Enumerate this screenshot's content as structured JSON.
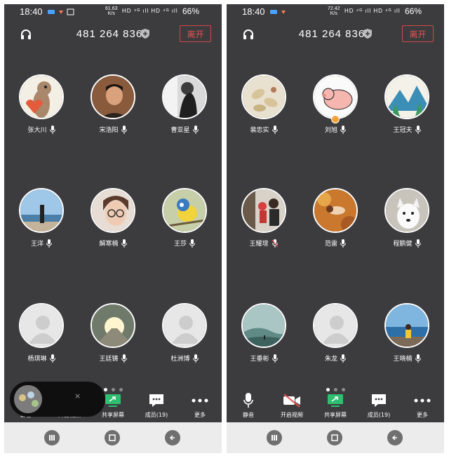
{
  "left_screen": {
    "status_bar": {
      "time": "18:40",
      "speed": "61.63",
      "speed_unit": "K/s",
      "network": "HD ⁴ᴳ ıll HD ⁴ᴳ ıll",
      "battery": "66%"
    },
    "meeting_id": "481 264 836",
    "leave_label": "离开",
    "participants": [
      {
        "name": "张大川",
        "avatar": "cartoon-dog-avatar"
      },
      {
        "name": "宋浩阳",
        "avatar": "man-portrait-avatar"
      },
      {
        "name": "曹亚星",
        "avatar": "bw-woman-avatar"
      },
      {
        "name": "王洋",
        "avatar": "seaside-person-avatar"
      },
      {
        "name": "解寒楠",
        "avatar": "glasses-girl-avatar"
      },
      {
        "name": "王莎",
        "avatar": "bird-avatar"
      },
      {
        "name": "杨琪琳",
        "avatar": "default-avatar"
      },
      {
        "name": "王廷铸",
        "avatar": "sunlight-road-avatar"
      },
      {
        "name": "杜洲博",
        "avatar": "default-avatar"
      }
    ],
    "toolbar": [
      {
        "label": "静音",
        "icon": "mic-icon"
      },
      {
        "label": "开启视频",
        "icon": "video-icon"
      },
      {
        "label": "共享屏幕",
        "icon": "share-screen-icon"
      },
      {
        "label": "成员(19)",
        "icon": "members-icon"
      },
      {
        "label": "更多",
        "icon": "more-icon"
      }
    ],
    "floating_close": "×"
  },
  "right_screen": {
    "status_bar": {
      "time": "18:40",
      "speed": "72.42",
      "speed_unit": "K/s",
      "network": "HD ⁴ᴳ ıll HD ⁴ᴳ ıll",
      "battery": "66%"
    },
    "meeting_id": "481 264 836",
    "leave_label": "离开",
    "participants": [
      {
        "name": "裴忠实",
        "avatar": "peanuts-avatar"
      },
      {
        "name": "刘旭",
        "avatar": "pig-cartoon-avatar"
      },
      {
        "name": "王冠夫",
        "avatar": "mountain-art-avatar"
      },
      {
        "name": "王耀增",
        "avatar": "family-photo-avatar"
      },
      {
        "name": "范雷",
        "avatar": "autumn-leaves-avatar"
      },
      {
        "name": "程鹏健",
        "avatar": "white-dog-avatar"
      },
      {
        "name": "王垂彬",
        "avatar": "misty-landscape-avatar"
      },
      {
        "name": "朱龙",
        "avatar": "default-avatar"
      },
      {
        "name": "王晓楠",
        "avatar": "seaside-girl-avatar"
      }
    ],
    "toolbar": [
      {
        "label": "静音",
        "icon": "mic-icon"
      },
      {
        "label": "开启视频",
        "icon": "video-off-icon"
      },
      {
        "label": "共享屏幕",
        "icon": "share-screen-icon"
      },
      {
        "label": "成员(19)",
        "icon": "members-icon"
      },
      {
        "label": "更多",
        "icon": "more-icon"
      }
    ]
  },
  "colors": {
    "background": "#3c3b3e",
    "leave_red": "#e35353",
    "share_green": "#2fbf71",
    "muted_red": "#e25050"
  }
}
